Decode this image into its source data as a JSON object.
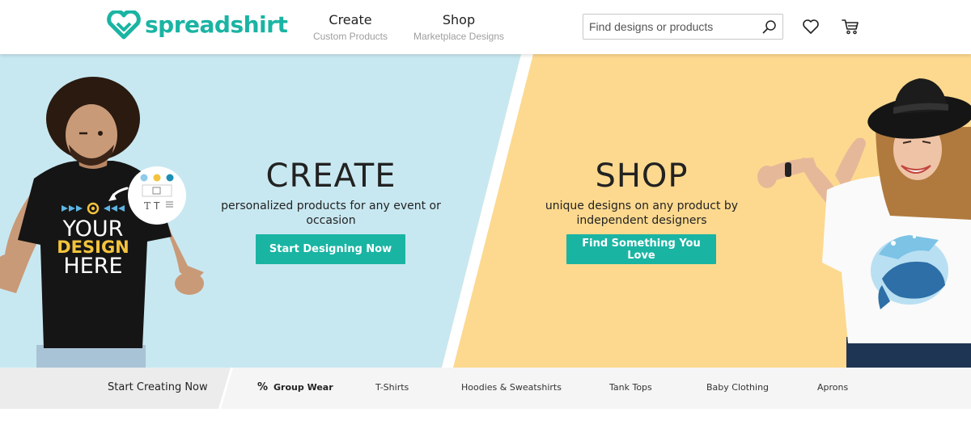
{
  "brand": {
    "name": "spreadshirt",
    "color": "#1ab4a3"
  },
  "nav": [
    {
      "label": "Create",
      "sublabel": "Custom Products"
    },
    {
      "label": "Shop",
      "sublabel": "Marketplace Designs"
    }
  ],
  "search": {
    "placeholder": "Find designs or products",
    "icon": "search-icon"
  },
  "header_icons": [
    "heart-icon",
    "cart-icon"
  ],
  "hero": {
    "create": {
      "title": "CREATE",
      "subtitle": "personalized products for any event or occasion",
      "button": "Start Designing Now",
      "background": "#c8e8f1"
    },
    "shop": {
      "title": "SHOP",
      "subtitle": "unique designs on any product by independent designers",
      "button": "Find Something You Love",
      "background": "#fcd98f"
    },
    "tshirt_print": {
      "line1": "YOUR",
      "line2": "DESIGN",
      "line3": "HERE"
    }
  },
  "category_bar": {
    "start_label": "Start Creating Now",
    "items": [
      {
        "label": "Group Wear",
        "icon": "percent-icon"
      },
      {
        "label": "T-Shirts"
      },
      {
        "label": "Hoodies & Sweatshirts"
      },
      {
        "label": "Tank Tops"
      },
      {
        "label": "Baby Clothing"
      },
      {
        "label": "Aprons"
      }
    ]
  }
}
